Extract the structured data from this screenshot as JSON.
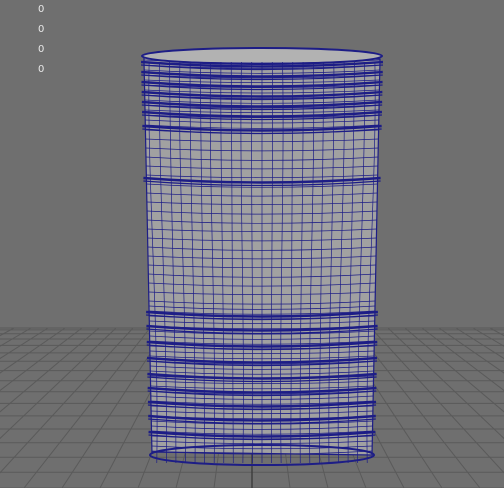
{
  "hud": {
    "lines": [
      "0",
      "0",
      "0",
      "0"
    ]
  },
  "colors": {
    "viewport_bg": "#6f6f6f",
    "grid_line": "#5a5a5a",
    "grid_axis": "#3c3c3c",
    "mesh_fill": "#a1a1a1",
    "wireframe": "#1d1d86"
  },
  "scene": {
    "object": "barrel-mesh",
    "display_mode": "wireframe-on-shaded"
  }
}
